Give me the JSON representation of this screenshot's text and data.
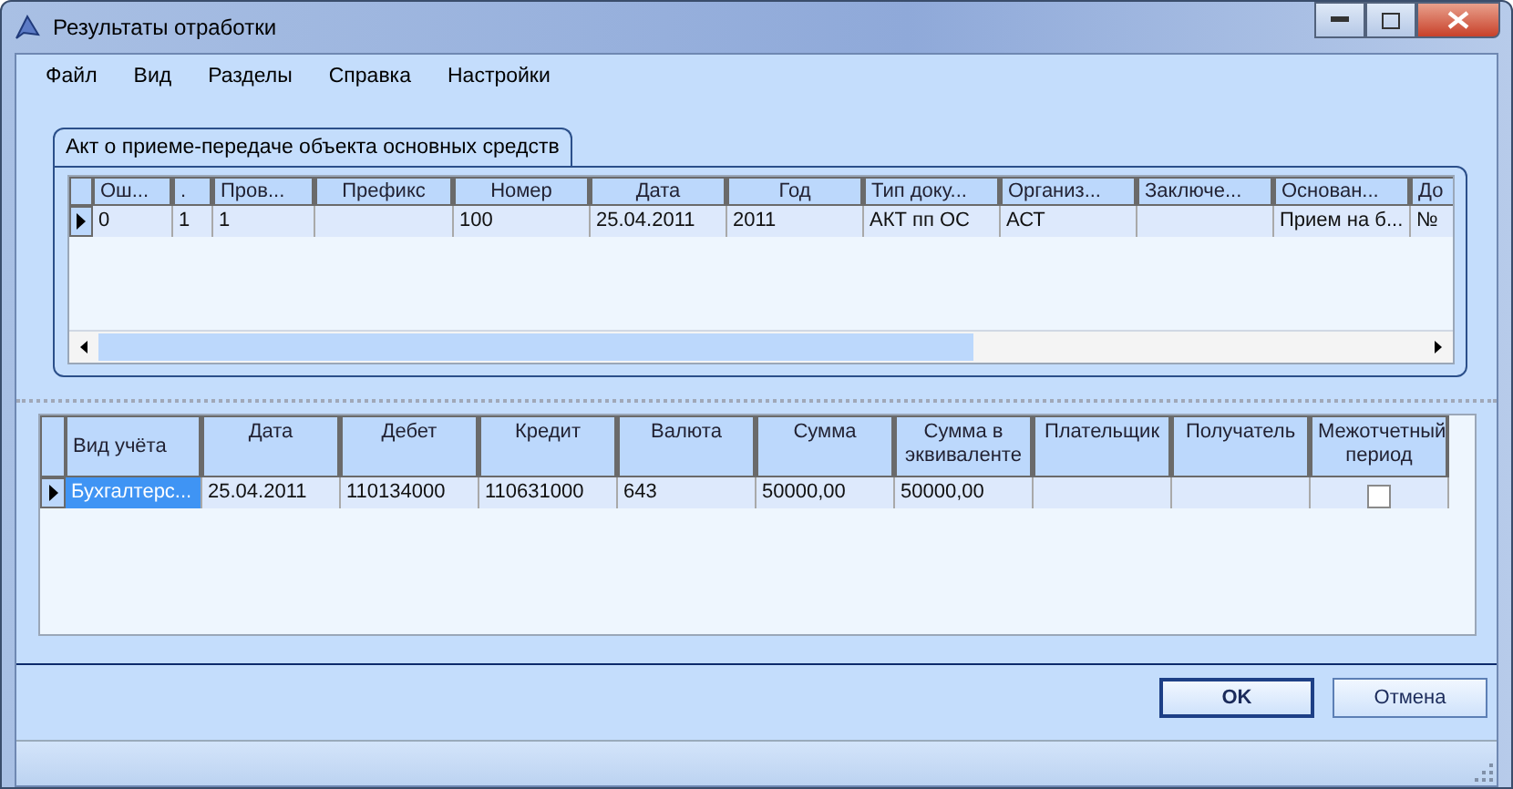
{
  "window": {
    "title": "Результаты отработки"
  },
  "menu": [
    {
      "label": "Файл"
    },
    {
      "label": "Вид"
    },
    {
      "label": "Разделы"
    },
    {
      "label": "Справка"
    },
    {
      "label": "Настройки"
    }
  ],
  "tabs": [
    {
      "label": "Акт о приеме-передаче объекта основных средств",
      "selected": true
    }
  ],
  "top_grid": {
    "columns": [
      {
        "label": "Ош...",
        "left_aligned": true
      },
      {
        "label": ".",
        "left_aligned": true
      },
      {
        "label": "Пров...",
        "left_aligned": true
      },
      {
        "label": "Префикс",
        "left_aligned": false
      },
      {
        "label": "Номер",
        "left_aligned": false
      },
      {
        "label": "Дата",
        "left_aligned": false
      },
      {
        "label": "Год",
        "left_aligned": false
      },
      {
        "label": "Тип доку...",
        "left_aligned": true
      },
      {
        "label": "Организ...",
        "left_aligned": true
      },
      {
        "label": "Заключе...",
        "left_aligned": true
      },
      {
        "label": "Основан...",
        "left_aligned": true
      },
      {
        "label": "До",
        "left_aligned": true
      }
    ],
    "rows": [
      {
        "current": true,
        "cells": [
          {
            "text": "0",
            "selected": false
          },
          {
            "text": "1",
            "selected": false
          },
          {
            "text": "1",
            "selected": false
          },
          {
            "text": "",
            "selected": false
          },
          {
            "text": "100",
            "selected": false
          },
          {
            "text": "25.04.2011",
            "selected": false
          },
          {
            "text": "2011",
            "selected": false
          },
          {
            "text": "АКТ пп ОС",
            "selected": false
          },
          {
            "text": "АСТ",
            "selected": false
          },
          {
            "text": "",
            "selected": false
          },
          {
            "text": "Прием на б...",
            "selected": false
          },
          {
            "text": "№",
            "selected": false
          }
        ]
      }
    ]
  },
  "bottom_grid": {
    "columns": [
      {
        "label": "Вид учёта",
        "left_aligned": true
      },
      {
        "label": "Дата",
        "left_aligned": false
      },
      {
        "label": "Дебет",
        "left_aligned": false
      },
      {
        "label": "Кредит",
        "left_aligned": false
      },
      {
        "label": "Валюта",
        "left_aligned": false
      },
      {
        "label": "Сумма",
        "left_aligned": false
      },
      {
        "label": "Сумма в эквиваленте",
        "left_aligned": false
      },
      {
        "label": "Плательщик",
        "left_aligned": false
      },
      {
        "label": "Получатель",
        "left_aligned": false
      },
      {
        "label": "Межотчетный период",
        "left_aligned": false
      }
    ],
    "rows": [
      {
        "current": true,
        "interperiod_checked": false,
        "cells": [
          {
            "text": "Бухгалтерс...",
            "selected": true
          },
          {
            "text": "25.04.2011",
            "selected": false
          },
          {
            "text": "110134000",
            "selected": false
          },
          {
            "text": "110631000",
            "selected": false
          },
          {
            "text": "643",
            "selected": false
          },
          {
            "text": "50000,00",
            "selected": false
          },
          {
            "text": "50000,00",
            "selected": false
          },
          {
            "text": "",
            "selected": false
          },
          {
            "text": "",
            "selected": false
          }
        ]
      }
    ]
  },
  "buttons": [
    {
      "label": "OK",
      "default": true
    },
    {
      "label": "Отмена",
      "default": false
    }
  ]
}
